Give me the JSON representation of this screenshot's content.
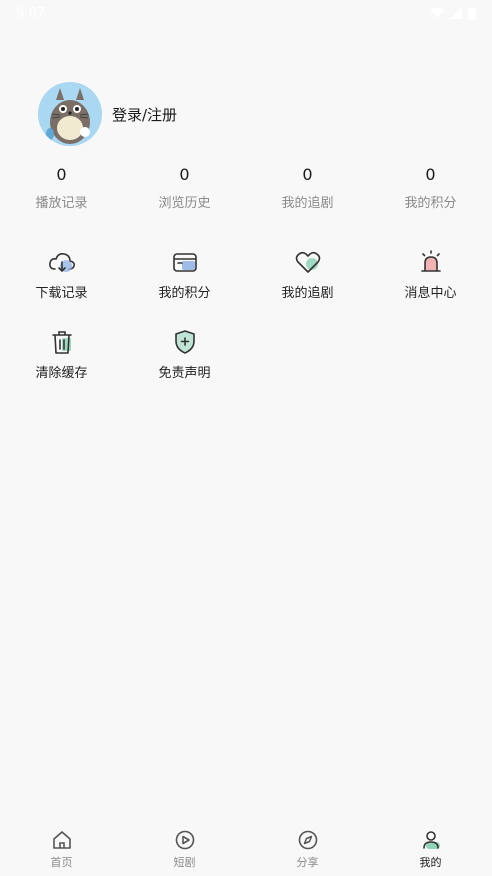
{
  "status_bar": {
    "time": "9:07"
  },
  "profile": {
    "login_label": "登录/注册"
  },
  "stats": [
    {
      "value": "0",
      "label": "播放记录"
    },
    {
      "value": "0",
      "label": "浏览历史"
    },
    {
      "value": "0",
      "label": "我的追剧"
    },
    {
      "value": "0",
      "label": "我的积分"
    }
  ],
  "menu": [
    {
      "label": "下载记录",
      "icon": "cloud-download-icon"
    },
    {
      "label": "我的积分",
      "icon": "wallet-card-icon"
    },
    {
      "label": "我的追剧",
      "icon": "heart-icon"
    },
    {
      "label": "消息中心",
      "icon": "alarm-bell-icon"
    },
    {
      "label": "清除缓存",
      "icon": "trash-icon"
    },
    {
      "label": "免责声明",
      "icon": "shield-plus-icon"
    }
  ],
  "tabs": [
    {
      "label": "首页",
      "icon": "home-icon",
      "active": false
    },
    {
      "label": "短剧",
      "icon": "play-circle-icon",
      "active": false
    },
    {
      "label": "分享",
      "icon": "compass-icon",
      "active": false
    },
    {
      "label": "我的",
      "icon": "user-icon",
      "active": true
    }
  ],
  "colors": {
    "accent_green": "#8fd3b8",
    "accent_blue": "#8fb1e6",
    "accent_pink": "#f2a7a7",
    "tab_active": "#1a1a1a",
    "tab_inactive": "#8a8a8a"
  }
}
